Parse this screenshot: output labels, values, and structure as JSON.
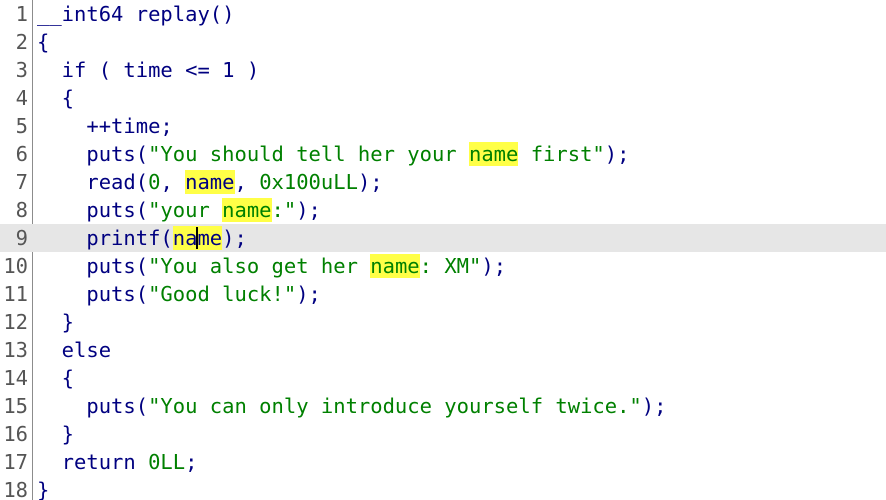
{
  "current_line": 9,
  "highlight_word": "name",
  "lines": [
    {
      "num": "1",
      "parts": [
        "__int64 replay()"
      ]
    },
    {
      "num": "2",
      "parts": [
        "{"
      ]
    },
    {
      "num": "3",
      "parts": [
        "  if ( time <= 1 )"
      ]
    },
    {
      "num": "4",
      "parts": [
        "  {"
      ]
    },
    {
      "num": "5",
      "parts": [
        "    ++time;"
      ]
    },
    {
      "num": "6",
      "parts": [
        "    puts(",
        "\"You should tell her your ",
        "name",
        " first\"",
        ");"
      ]
    },
    {
      "num": "7",
      "parts": [
        "    read(",
        "0",
        ", ",
        "name",
        ", ",
        "0x100uLL",
        ");"
      ]
    },
    {
      "num": "8",
      "parts": [
        "    puts(",
        "\"your ",
        "name",
        ":\"",
        ");"
      ]
    },
    {
      "num": "9",
      "parts": [
        "    printf(",
        "na",
        "me",
        ");"
      ]
    },
    {
      "num": "10",
      "parts": [
        "    puts(",
        "\"You also get her ",
        "name",
        ": XM\"",
        ");"
      ]
    },
    {
      "num": "11",
      "parts": [
        "    puts(",
        "\"Good luck!\"",
        ");"
      ]
    },
    {
      "num": "12",
      "parts": [
        "  }"
      ]
    },
    {
      "num": "13",
      "parts": [
        "  else"
      ]
    },
    {
      "num": "14",
      "parts": [
        "  {"
      ]
    },
    {
      "num": "15",
      "parts": [
        "    puts(",
        "\"You can only introduce yourself twice.\"",
        ");"
      ]
    },
    {
      "num": "16",
      "parts": [
        "  }"
      ]
    },
    {
      "num": "17",
      "parts": [
        "  return ",
        "0LL",
        ";"
      ]
    },
    {
      "num": "18",
      "parts": [
        "}"
      ]
    }
  ],
  "colors": {
    "keyword": "#000080",
    "string": "#008000",
    "number": "#008000",
    "highlight": "#ffff47",
    "current_line": "#e6e6e6",
    "gutter_text": "#555555"
  }
}
